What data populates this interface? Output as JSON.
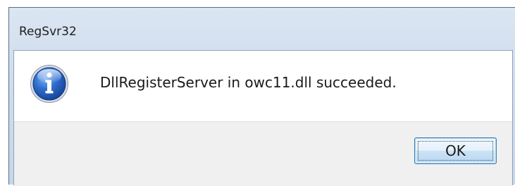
{
  "window": {
    "title": "RegSvr32"
  },
  "dialog": {
    "icon": "info-icon",
    "message": "DllRegisterServer in owc11.dll succeeded.",
    "ok_label": "OK"
  },
  "colors": {
    "icon_blue": "#1f5bb8",
    "button_border": "#3c7fb1",
    "button_bar": "#f0f0f0"
  }
}
